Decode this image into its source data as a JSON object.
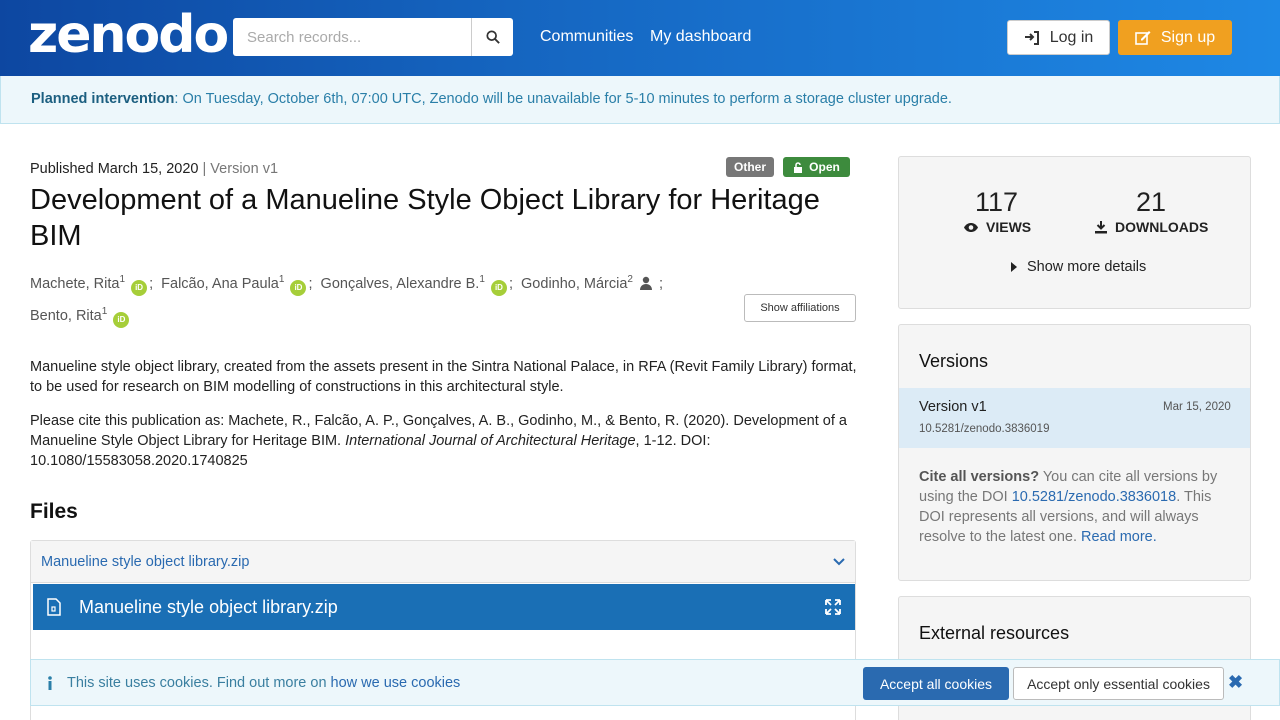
{
  "header": {
    "logo": "zenodo",
    "search_placeholder": "Search records...",
    "nav": [
      "Communities",
      "My dashboard"
    ],
    "login_label": "Log in",
    "signup_label": "Sign up"
  },
  "banner": {
    "bold": "Planned intervention",
    "text": ": On Tuesday, October 6th, 07:00 UTC, Zenodo will be unavailable for 5-10 minutes to perform a storage cluster upgrade."
  },
  "record": {
    "published": "Published March 15, 2020",
    "version": " | Version v1",
    "badge_other": "Other",
    "badge_open": "Open",
    "title": "Development of a Manueline Style Object Library for Heritage BIM",
    "authors": [
      {
        "name": "Machete, Rita",
        "sup": "1",
        "orcid": true
      },
      {
        "name": "Falcão, Ana Paula",
        "sup": "1",
        "orcid": true
      },
      {
        "name": "Gonçalves, Alexandre B.",
        "sup": "1",
        "orcid": true
      },
      {
        "name": "Godinho, Márcia",
        "sup": "2",
        "orcid": false
      },
      {
        "name": "Bento, Rita",
        "sup": "1",
        "orcid": true
      }
    ],
    "orcid_label": "iD",
    "show_affiliations": "Show affiliations",
    "description": "Manueline style object library, created from the assets present in the Sintra National Palace, in RFA (Revit Family Library) format, to be used for research on BIM modelling of constructions in this architectural style.",
    "cite_prefix": "Please cite this publication as: Machete, R., Falcão, A. P., Gonçalves, A. B., Godinho, M., & Bento, R. (2020). Development of a Manueline Style Object Library for Heritage BIM. ",
    "cite_journal": "International Journal of Architectural Heritage",
    "cite_suffix": ", 1-12. DOI: 10.1080/15583058.2020.1740825"
  },
  "files": {
    "heading": "Files",
    "panel_title": "Manueline style object library.zip",
    "preview_name": "Manueline style object library.zip"
  },
  "stats": {
    "views": "117",
    "views_label": "VIEWS",
    "downloads": "21",
    "downloads_label": "DOWNLOADS",
    "more_details": "Show more details"
  },
  "versions": {
    "heading": "Versions",
    "item_label": "Version v1",
    "item_date": "Mar 15, 2020",
    "item_doi": "10.5281/zenodo.3836019",
    "cite_bold": "Cite all versions?",
    "cite_text1": " You can cite all versions by using the DOI ",
    "cite_doi": "10.5281/zenodo.3836018",
    "cite_text2": ". This DOI represents all versions, and will always resolve to the latest one. ",
    "read_more": "Read more."
  },
  "external": {
    "heading": "External resources"
  },
  "cookie": {
    "text": "This site uses cookies. Find out more on ",
    "link": "how we use cookies",
    "accept_all": "Accept all cookies",
    "accept_essential": "Accept only essential cookies",
    "close": "✖"
  },
  "colors": {
    "header_start": "#0d47a1",
    "header_end": "#1e88e5",
    "signup": "#f0a020",
    "open_badge": "#3d8b3d",
    "orcid": "#a6ce39",
    "link": "#2a6ab0"
  }
}
